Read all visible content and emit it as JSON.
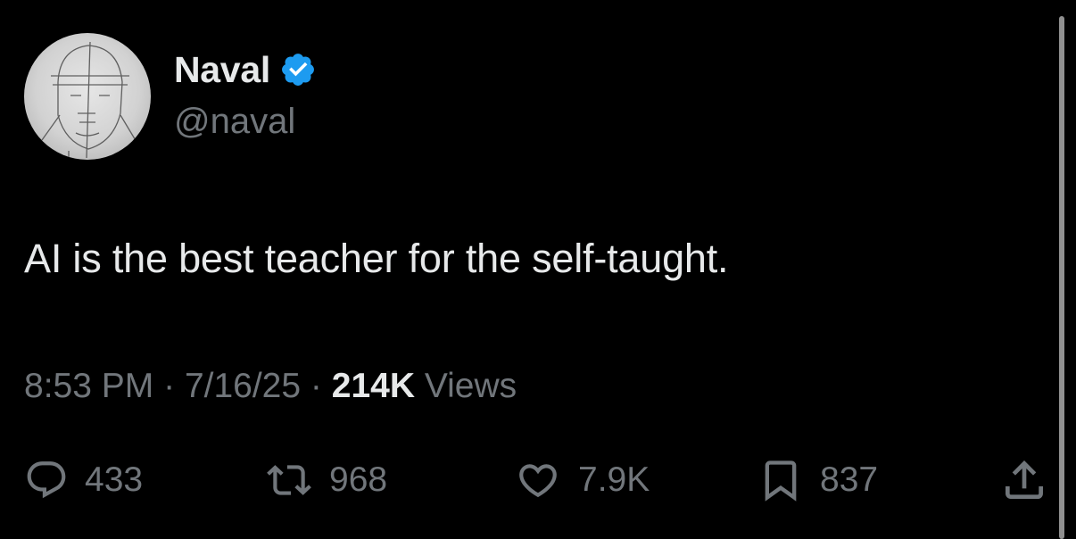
{
  "tweet": {
    "author": {
      "display_name": "Naval",
      "handle": "@naval",
      "verified": true,
      "verified_icon": "verified-badge-icon",
      "verified_color": "#1d9bf0"
    },
    "text": "AI is the best teacher for the self-taught.",
    "meta": {
      "time": "8:53 PM",
      "separator": "·",
      "date": "7/16/25",
      "views_count": "214K",
      "views_label": "Views"
    },
    "actions": {
      "reply": {
        "icon": "reply-icon",
        "count": "433"
      },
      "retweet": {
        "icon": "retweet-icon",
        "count": "968"
      },
      "like": {
        "icon": "heart-icon",
        "count": "7.9K"
      },
      "bookmark": {
        "icon": "bookmark-icon",
        "count": "837"
      },
      "share": {
        "icon": "share-icon"
      }
    }
  },
  "theme": {
    "background": "#000000",
    "primary_text": "#e7e9ea",
    "secondary_text": "#71767b",
    "accent": "#1d9bf0"
  }
}
